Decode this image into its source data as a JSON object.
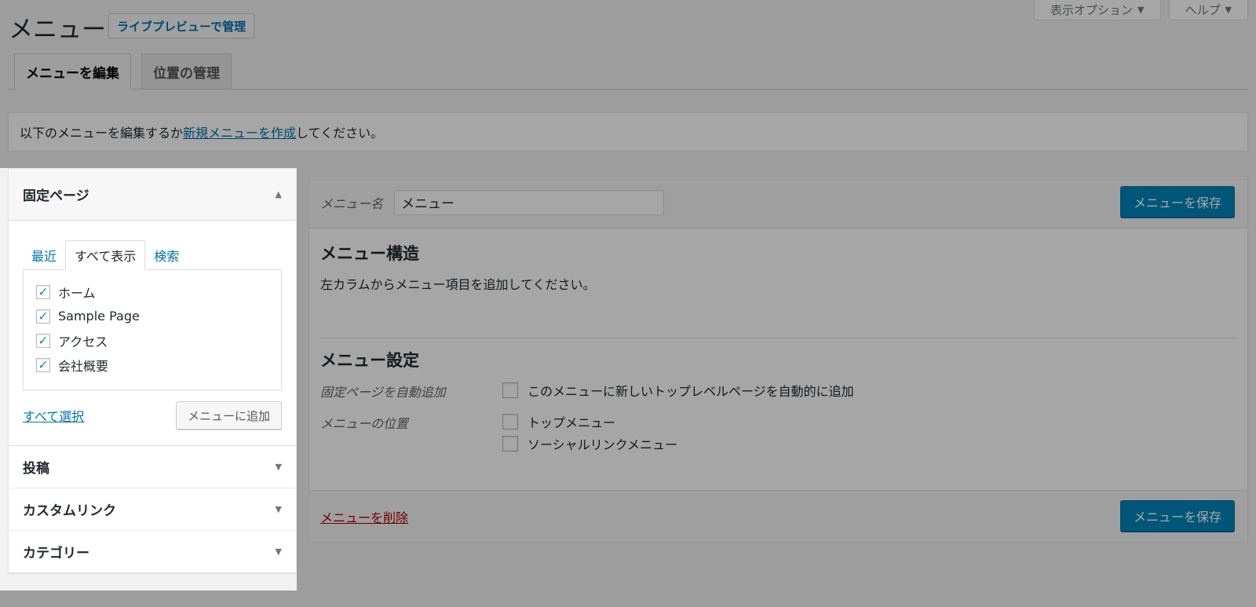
{
  "screen_meta": {
    "options_label": "表示オプション",
    "help_label": "ヘルプ"
  },
  "header": {
    "title": "メニュー",
    "live_preview": "ライブプレビューで管理"
  },
  "nav_tabs": [
    {
      "label": "メニューを編集"
    },
    {
      "label": "位置の管理"
    }
  ],
  "notice": {
    "before": "以下のメニューを編集するか",
    "link": "新規メニューを作成",
    "after": "してください。"
  },
  "side_panel": {
    "pages_title": "固定ページ",
    "tabs": [
      {
        "label": "最近"
      },
      {
        "label": "すべて表示"
      },
      {
        "label": "検索"
      }
    ],
    "pages": [
      {
        "label": "ホーム",
        "checked": true
      },
      {
        "label": "Sample Page",
        "checked": true
      },
      {
        "label": "アクセス",
        "checked": true
      },
      {
        "label": "会社概要",
        "checked": true
      }
    ],
    "select_all": "すべて選択",
    "add_to_menu": "メニューに追加",
    "sections": [
      {
        "label": "投稿"
      },
      {
        "label": "カスタムリンク"
      },
      {
        "label": "カテゴリー"
      }
    ]
  },
  "menu_editor": {
    "name_label": "メニュー名",
    "name_value": "メニュー",
    "save_label": "メニューを保存",
    "structure_title": "メニュー構造",
    "structure_hint": "左カラムからメニュー項目を追加してください。",
    "settings_title": "メニュー設定",
    "auto_add_label": "固定ページを自動追加",
    "auto_add_option": "このメニューに新しいトップレベルページを自動的に追加",
    "location_label": "メニューの位置",
    "locations": [
      {
        "label": "トップメニュー"
      },
      {
        "label": "ソーシャルリンクメニュー"
      }
    ],
    "delete_label": "メニューを削除"
  }
}
